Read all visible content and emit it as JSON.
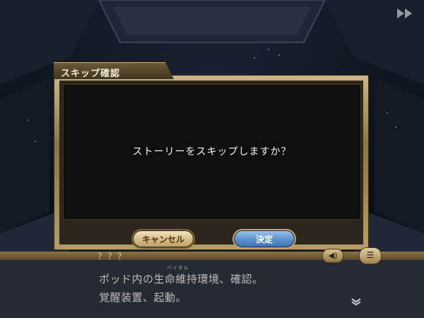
{
  "dialog": {
    "title": "スキップ確認",
    "message": "ストーリーをスキップしますか？",
    "cancel_label": "キャンセル",
    "confirm_label": "決定"
  },
  "textbox": {
    "speaker": "？？？",
    "ruby": "バイタル",
    "line1": "ポッド内の生命維持環境、確認。",
    "line2": "覚醒装置、起動。"
  },
  "icons": {
    "fast_forward": "fast-forward-icon",
    "voice": "speaker-icon",
    "log": "log-icon",
    "next": "chevron-down-icon"
  },
  "colors": {
    "frame_gold": "#b69c66",
    "cancel_button": "#d6bf8c",
    "confirm_button": "#5f95cf",
    "dialog_body": "#0f0f0f"
  }
}
